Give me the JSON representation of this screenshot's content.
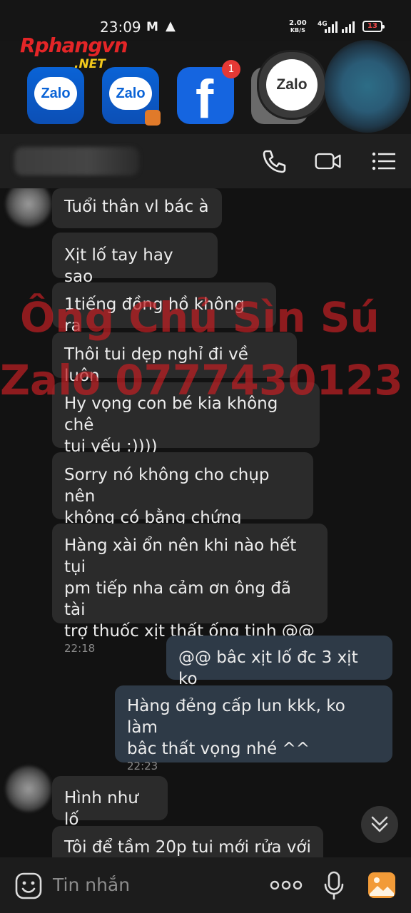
{
  "status_bar": {
    "time": "23:09",
    "net_speed_value": "2.00",
    "net_speed_unit": "KB/S",
    "network": "4G",
    "battery": "13"
  },
  "watermark_site": {
    "brand_first": "R",
    "brand_rest": "phangvn",
    "domain": ".NET"
  },
  "app_strip": {
    "zalo_label_1": "Zalo",
    "zalo_label_2": "Zalo",
    "facebook_badge": "1",
    "floating_bubble_label": "Zalo"
  },
  "watermark": {
    "line1": "Ông Chủ Sìn Sú",
    "line2": "Zalo 0777430123"
  },
  "messages": [
    {
      "side": "received",
      "text": "Tuổi thân vl bác à"
    },
    {
      "side": "received",
      "text": "Xịt lố tay hay sao"
    },
    {
      "side": "received",
      "text": "1tiếng đồng hồ không ra"
    },
    {
      "side": "received",
      "text": "Thôi tui dẹp nghỉ đi về luôn"
    },
    {
      "side": "received",
      "line1": "Hy vọng con bé kia không chê",
      "line2": "tui yếu :))))"
    },
    {
      "side": "received",
      "line1": "Sorry nó không cho chụp nên",
      "line2": "không có bằng chứng"
    },
    {
      "side": "received",
      "line1": "Hàng xài ổn nên khi nào hết tụi",
      "line2": "pm tiếp nha cảm ơn ông đã tài",
      "line3": "trợ thuốc xịt thất ống tinh @@",
      "time": "22:18"
    },
    {
      "side": "sent",
      "text": "@@ bâc xịt lố đc 3 xịt ko"
    },
    {
      "side": "sent",
      "line1": "Hàng đẻng cấp  lun kkk, ko làm",
      "line2": "bâc thất vọng nhé ^^",
      "time": "22:23"
    },
    {
      "side": "received",
      "text": "Hình như lố"
    },
    {
      "side": "received",
      "text": "Tôi để tầm 20p tui mới rửa với"
    }
  ],
  "input": {
    "placeholder": "Tin nhắn"
  },
  "colors": {
    "background": "#121212",
    "received_bubble": "#2b2b2b",
    "sent_bubble": "#2e3a47",
    "header": "#1f1f1f",
    "watermark": "#be1e23",
    "zalo_blue": "#0a63d6"
  },
  "icons": {
    "header": [
      "phone-icon",
      "video-call-icon",
      "menu-icon"
    ],
    "input": [
      "emoji-icon",
      "more-icon",
      "microphone-icon",
      "image-icon"
    ],
    "scroll": "chevron-double-down-icon"
  }
}
